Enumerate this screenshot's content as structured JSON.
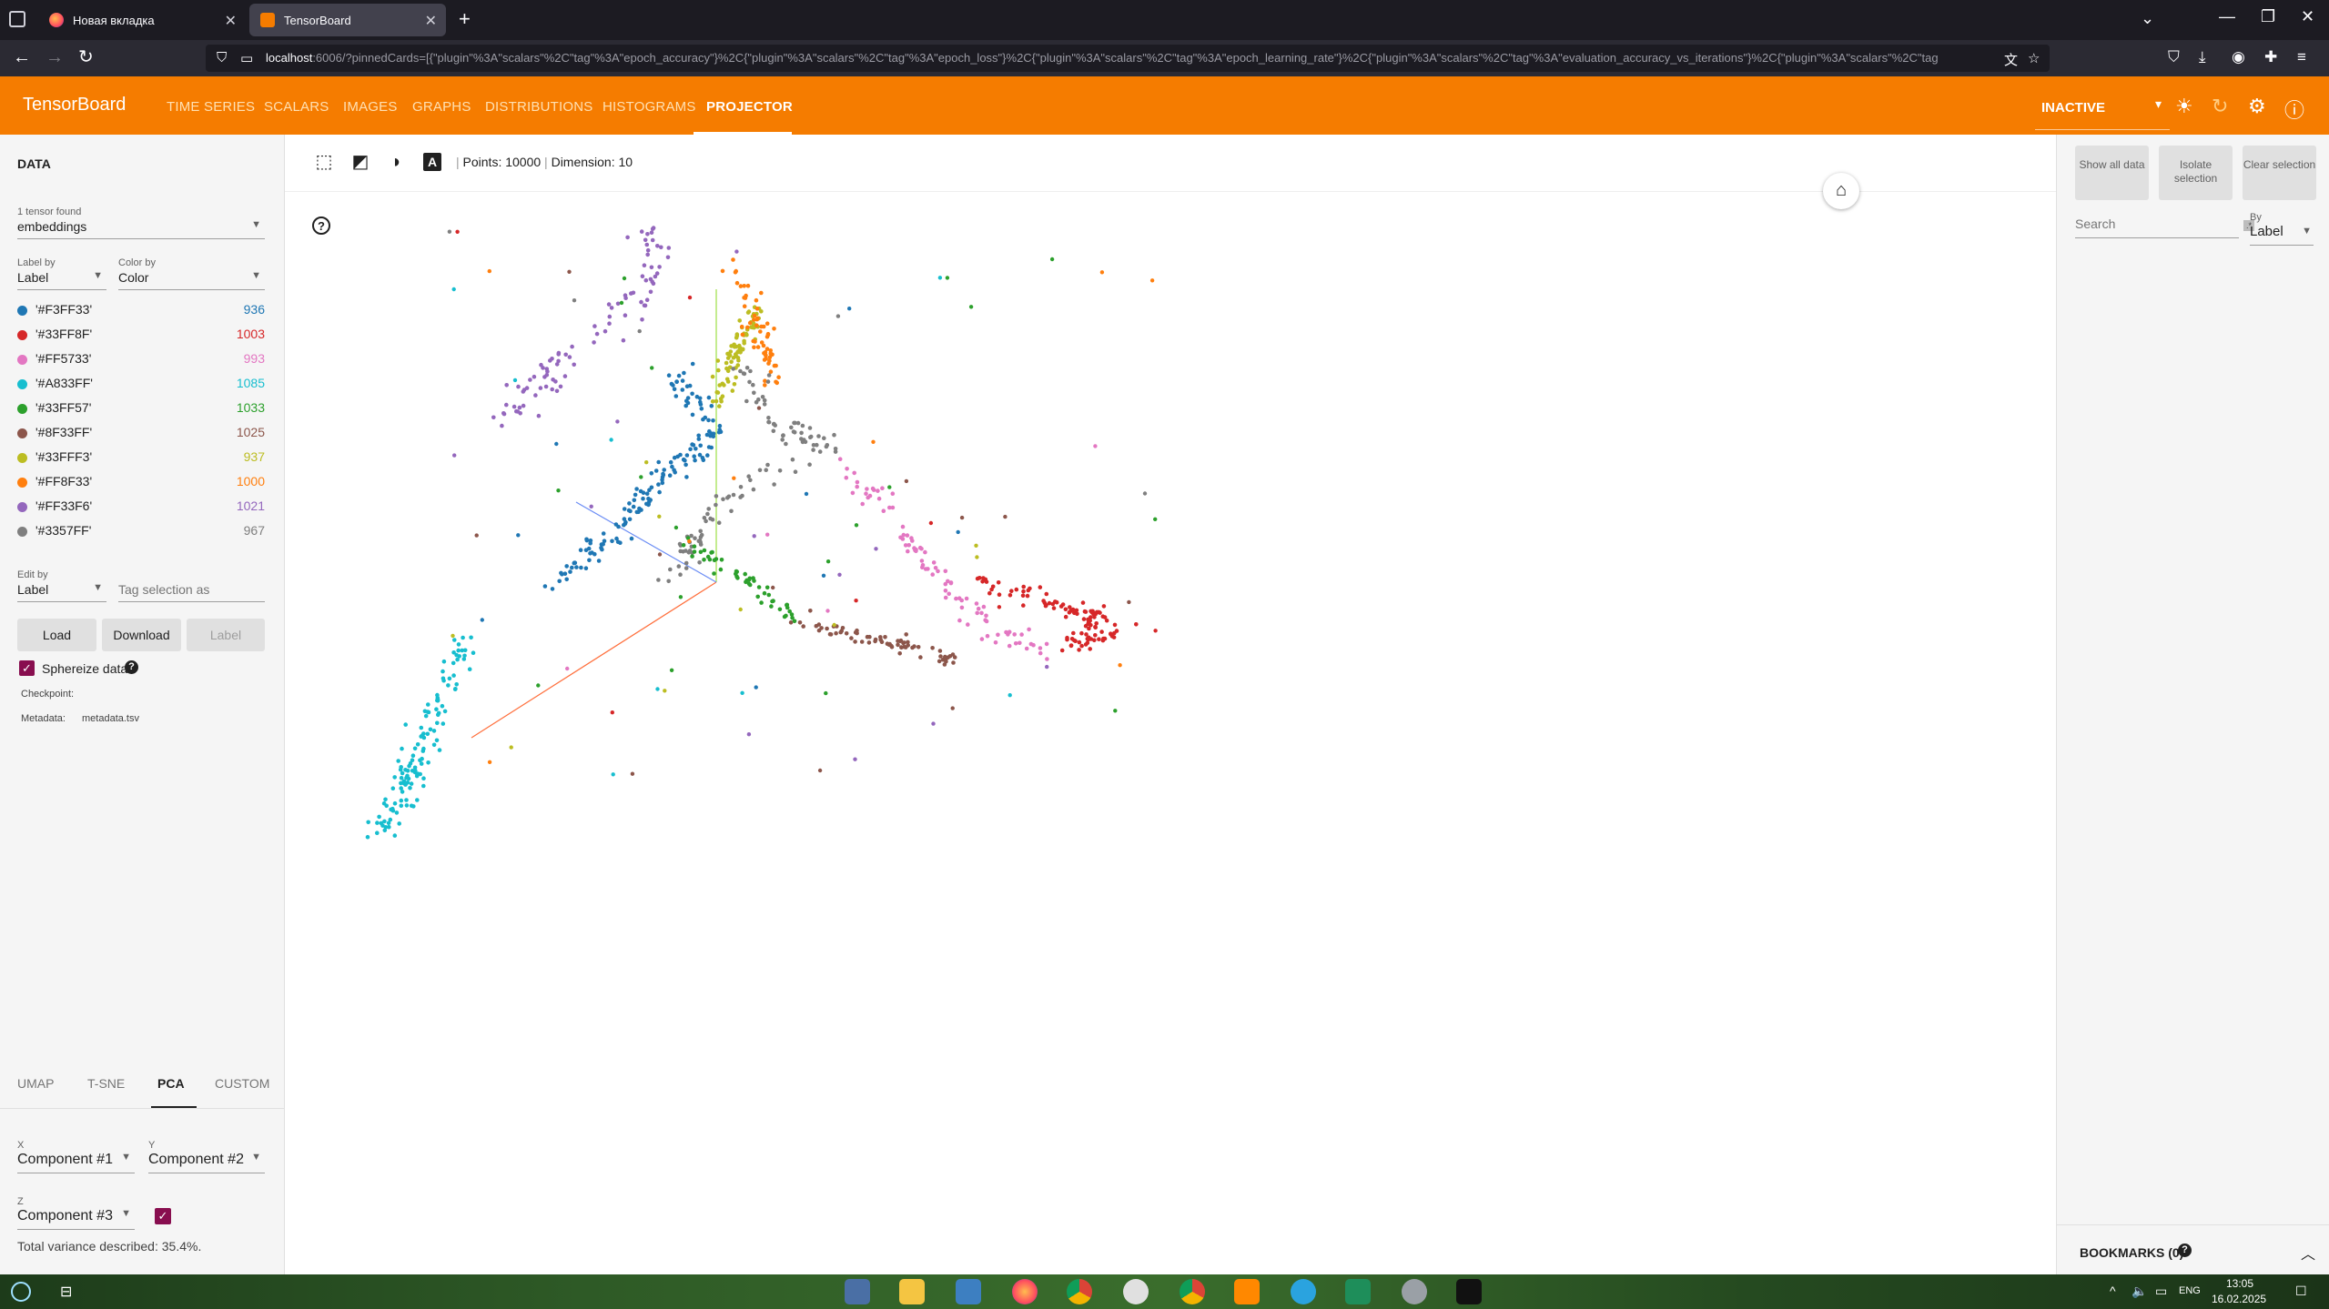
{
  "browser": {
    "tabs": [
      {
        "title": "Новая вкладка"
      },
      {
        "title": "TensorBoard"
      }
    ],
    "new_tab": "+",
    "url_host": "localhost",
    "url_rest": ":6006/?pinnedCards=[{\"plugin\"%3A\"scalars\"%2C\"tag\"%3A\"epoch_accuracy\"}%2C{\"plugin\"%3A\"scalars\"%2C\"tag\"%3A\"epoch_loss\"}%2C{\"plugin\"%3A\"scalars\"%2C\"tag\"%3A\"epoch_learning_rate\"}%2C{\"plugin\"%3A\"scalars\"%2C\"tag\"%3A\"evaluation_accuracy_vs_iterations\"}%2C{\"plugin\"%3A\"scalars\"%2C\"tag"
  },
  "tb": {
    "brand": "TensorBoard",
    "tabs": [
      "TIME SERIES",
      "SCALARS",
      "IMAGES",
      "GRAPHS",
      "DISTRIBUTIONS",
      "HISTOGRAMS",
      "PROJECTOR"
    ],
    "active_tab": "PROJECTOR",
    "run_state": "INACTIVE"
  },
  "left": {
    "title": "DATA",
    "tensor_found": "1 tensor found",
    "tensor": "embeddings",
    "label_by_lbl": "Label by",
    "label_by": "Label",
    "color_by_lbl": "Color by",
    "color_by": "Color",
    "legend": [
      {
        "name": "'#F3FF33'",
        "count": "936",
        "color": "#1f77b4"
      },
      {
        "name": "'#33FF8F'",
        "count": "1003",
        "color": "#d62728"
      },
      {
        "name": "'#FF5733'",
        "count": "993",
        "color": "#e377c2"
      },
      {
        "name": "'#A833FF'",
        "count": "1085",
        "color": "#17becf"
      },
      {
        "name": "'#33FF57'",
        "count": "1033",
        "color": "#2ca02c"
      },
      {
        "name": "'#8F33FF'",
        "count": "1025",
        "color": "#8c564b"
      },
      {
        "name": "'#33FFF3'",
        "count": "937",
        "color": "#bcbd22"
      },
      {
        "name": "'#FF8F33'",
        "count": "1000",
        "color": "#ff7f0e"
      },
      {
        "name": "'#FF33F6'",
        "count": "1021",
        "color": "#9467bd"
      },
      {
        "name": "'#3357FF'",
        "count": "967",
        "color": "#7f7f7f"
      }
    ],
    "edit_by_lbl": "Edit by",
    "edit_by": "Label",
    "tag_placeholder": "Tag selection as",
    "load": "Load",
    "download": "Download",
    "label_btn": "Label",
    "sphereize": "Sphereize data",
    "checkpoint_lbl": "Checkpoint:",
    "metadata_lbl": "Metadata:",
    "metadata_val": "metadata.tsv",
    "methods": [
      "UMAP",
      "T-SNE",
      "PCA",
      "CUSTOM"
    ],
    "active_method": "PCA",
    "x_lbl": "X",
    "x_val": "Component #1",
    "y_lbl": "Y",
    "y_val": "Component #2",
    "z_lbl": "Z",
    "z_val": "Component #3",
    "variance": "Total variance described: 35.4%."
  },
  "main": {
    "points_label": "Points: 10000",
    "dimension_label": "Dimension: 10",
    "sep": "|"
  },
  "right": {
    "show_all": "Show all data",
    "isolate": "Isolate selection",
    "clear": "Clear selection",
    "search_placeholder": "Search",
    "by_lbl": "By",
    "by_val": "Label",
    "bookmarks": "BOOKMARKS (0)"
  },
  "taskbar": {
    "time": "13:05",
    "date": "16.02.2025",
    "lang": "ENG"
  },
  "colors": {
    "accent": "#f57c00",
    "checkbox": "#880e4f",
    "axis_x": "#ff6f3c",
    "axis_y": "#9cdf45",
    "axis_z": "#6c8ef5"
  }
}
